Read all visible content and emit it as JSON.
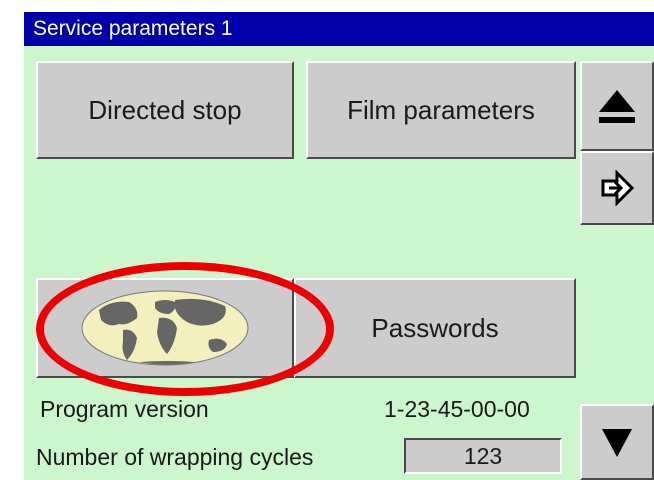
{
  "window": {
    "title": "Service parameters 1"
  },
  "buttons": {
    "directed_stop": "Directed stop",
    "film_parameters": "Film parameters",
    "passwords": "Passwords",
    "language": {
      "icon": "world-map-icon"
    },
    "eject": {
      "icon": "eject-icon"
    },
    "enter": {
      "icon": "enter-arrow-icon"
    },
    "scroll_down": {
      "icon": "down-triangle-icon"
    }
  },
  "info": {
    "program_version_label": "Program version",
    "program_version_value": "1-23-45-00-00",
    "wrapping_cycles_label": "Number of wrapping cycles",
    "wrapping_cycles_value": "123"
  },
  "colors": {
    "titlebar": "#0000aa",
    "background": "#ccf7cc",
    "button": "#cccccc",
    "highlight": "#ee0000"
  }
}
